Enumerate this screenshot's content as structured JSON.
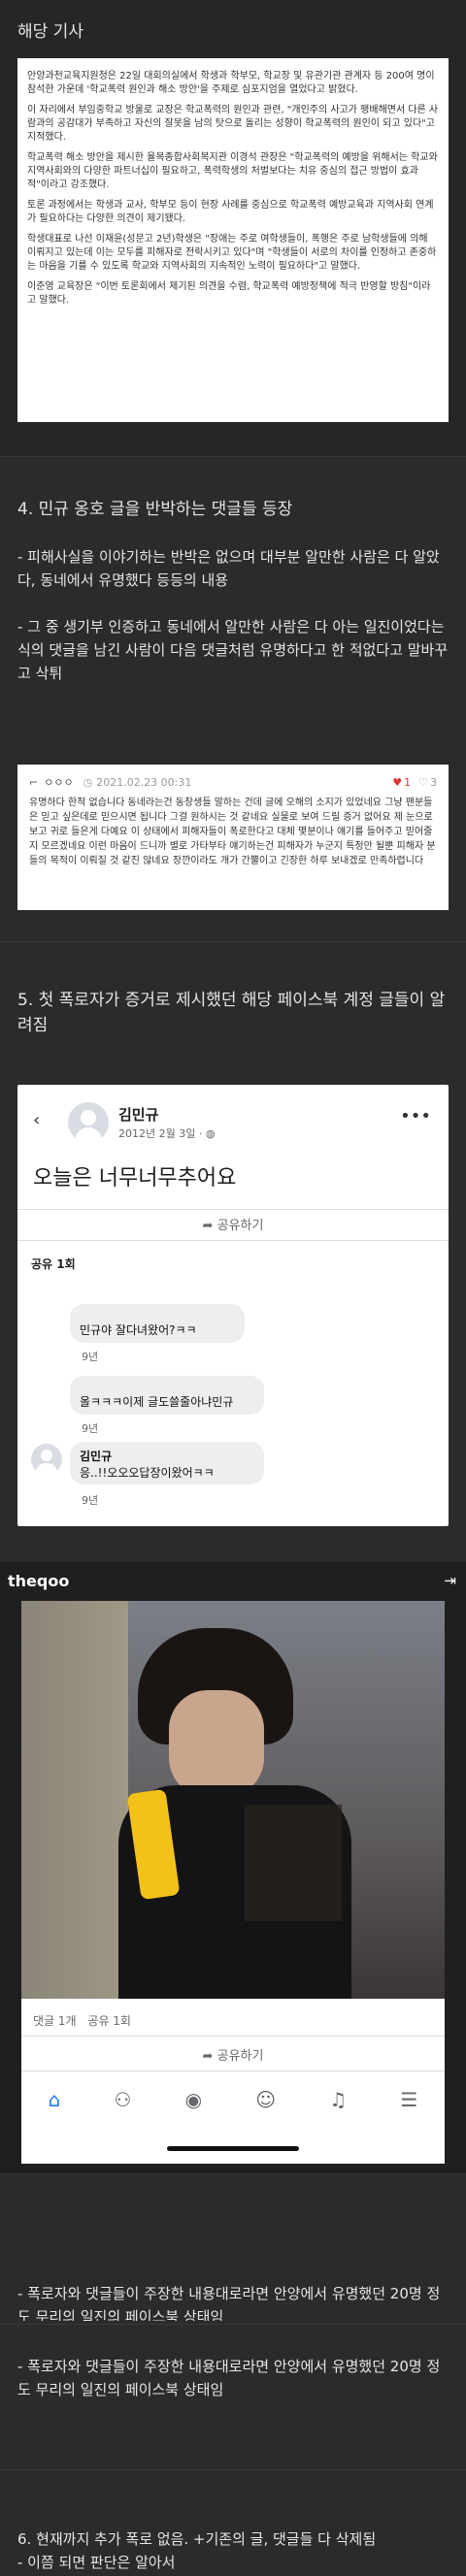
{
  "s1": {
    "title": "해당 기사",
    "paragraphs": [
      "안양과천교육지원청은 22일 대회의실에서 학생과 학부모, 학교장 및 유관기관 관계자 등 200여 명이 참석한 가운데 '학교폭력 원인과 해소 방안'을 주제로 심포지엄을 열었다고 밝혔다.",
      "이 자리에서 부임중학교 방울로 교장은 학교폭력의 원인과 관련, \"개인주의 사고가 팽배해면서 다른 사람과의 공감대가 부족하고 자신의 잘못을 남의 탓으로 돌리는 성향이 학교폭력의 원인이 되고 있다\"고 지적했다.",
      "학교폭력 해소 방안을 제시한 율목종합사회복지관 이경석 관장은 \"학교폭력의 예방을 위해서는 학교와 지역사회와의 다양한 파트너십이 필요하고, 폭력학생의 처벌보다는 치유 중심의 접근 방법이 효과적\"이라고 강조했다.",
      "토론 과정에서는 학생과 교사, 학부모 등이 현장 사례를 중심으로 학교폭력 예방교육과 지역사회 연계가 필요하다는 다양한 의견이 제기됐다.",
      "학생대표로 나선 이재윤(성문고 2년)학생은 \"장애는 주로 여학생들이, 폭행은 주로 남학생들에 의해 이뤄지고 있는데 이는 모두를 피해자로 전락시키고 있다\"며 \"학생들이 서로의 차이를 인정하고 존중하는 마음을 기를 수 있도록 학교와 지역사회의 지속적인 노력이 필요하다\"고 말했다.",
      "이준영 교육장은 \"이번 토론회에서 제기된 의견을 수렴, 학교폭력 예방정책에 적극 반영할 방침\"이라고 말했다."
    ]
  },
  "s2": {
    "heading": "4. 민규 옹호 글을 반박하는 댓글들 등장",
    "p1": "- 피해사실을 이야기하는 반박은 없으며 대부분 알만한 사람은 다 알았다, 동네에서 유명했다 등등의 내용",
    "p2": "- 그 중 생기부 인증하고 동네에서 알만한 사람은 다 아는 일진이었다는 식의 댓글을 남긴 사람이 다음 댓글처럼 유명하다고 한 적없다고 말바꾸고 삭튀",
    "comment_user": "ㅇㅇㅇ",
    "comment_date": "2021.02.23 00:31",
    "comment_up": "1",
    "comment_down": "3",
    "comment_text": "유명하다 한적 없습니다 동네라는건 동창생들 말하는 건데 글에 오해의 소지가 있었네요 그냥 팬분들은 믿고 싶은데로 믿으시면 됩니다 그걸 원하시는 것 같네요 실물로 보여 드릴 증거 없어요 제 눈으로 보고 귀로 들은게 다예요 이 상태에서 피해자들이 폭로한다고 대체 몇분이나 얘기를 들어주고 믿어줄지 모르겠네요 이런 마음이 드니까 별로 가타부타 얘기하는건 피해자가 누군지 특정만 될뿐 피해자 분들의 목적이 이뤄질 것 같진 않네요 장깐이라도 개가 간뿔이고 긴장한 하루 보내겠로 만족하렵니다"
  },
  "s3": {
    "heading": "5. 첫 폭로자가 증거로 제시했던 해당 페이스북 계정 글들이 알려짐",
    "fb_name": "김민규",
    "fb_date": "2012년 2월 3일 ·",
    "fb_post": "오늘은 너무너무추어요",
    "share_label": "공유하기",
    "share_count": "공유 1회",
    "comments": [
      {
        "text": "민규야 잘다녀왔어?ㅋㅋ",
        "time": "9년"
      },
      {
        "text": "올ㅋㅋㅋ이제 글도쓸줄아냐민규",
        "time": "9년"
      },
      {
        "name": "김민규",
        "text": "응..!!오오오답장이왔어ㅋㅋ",
        "time": "9년"
      }
    ]
  },
  "s4": {
    "brand": "theqoo",
    "comments_count": "댓글 1개",
    "share_count": "공유 1회",
    "share_label": "공유하기"
  },
  "s5": {
    "text": "- 폭로자와 댓글들이 주장한 내용대로라면 안양에서 유명했던 20명 정도 무리의 일진의 페이스북 상태임"
  },
  "s6": {
    "text": "- 폭로자와 댓글들이 주장한 내용대로라면 안양에서 유명했던 20명 정도 무리의 일진의 페이스북 상태임"
  },
  "s7": {
    "line1": "6. 현재까지 추가 폭로 없음. +기존의 글, 댓글들 다 삭제됨",
    "line2": "- 이쯤 되면 판단은 알아서"
  }
}
